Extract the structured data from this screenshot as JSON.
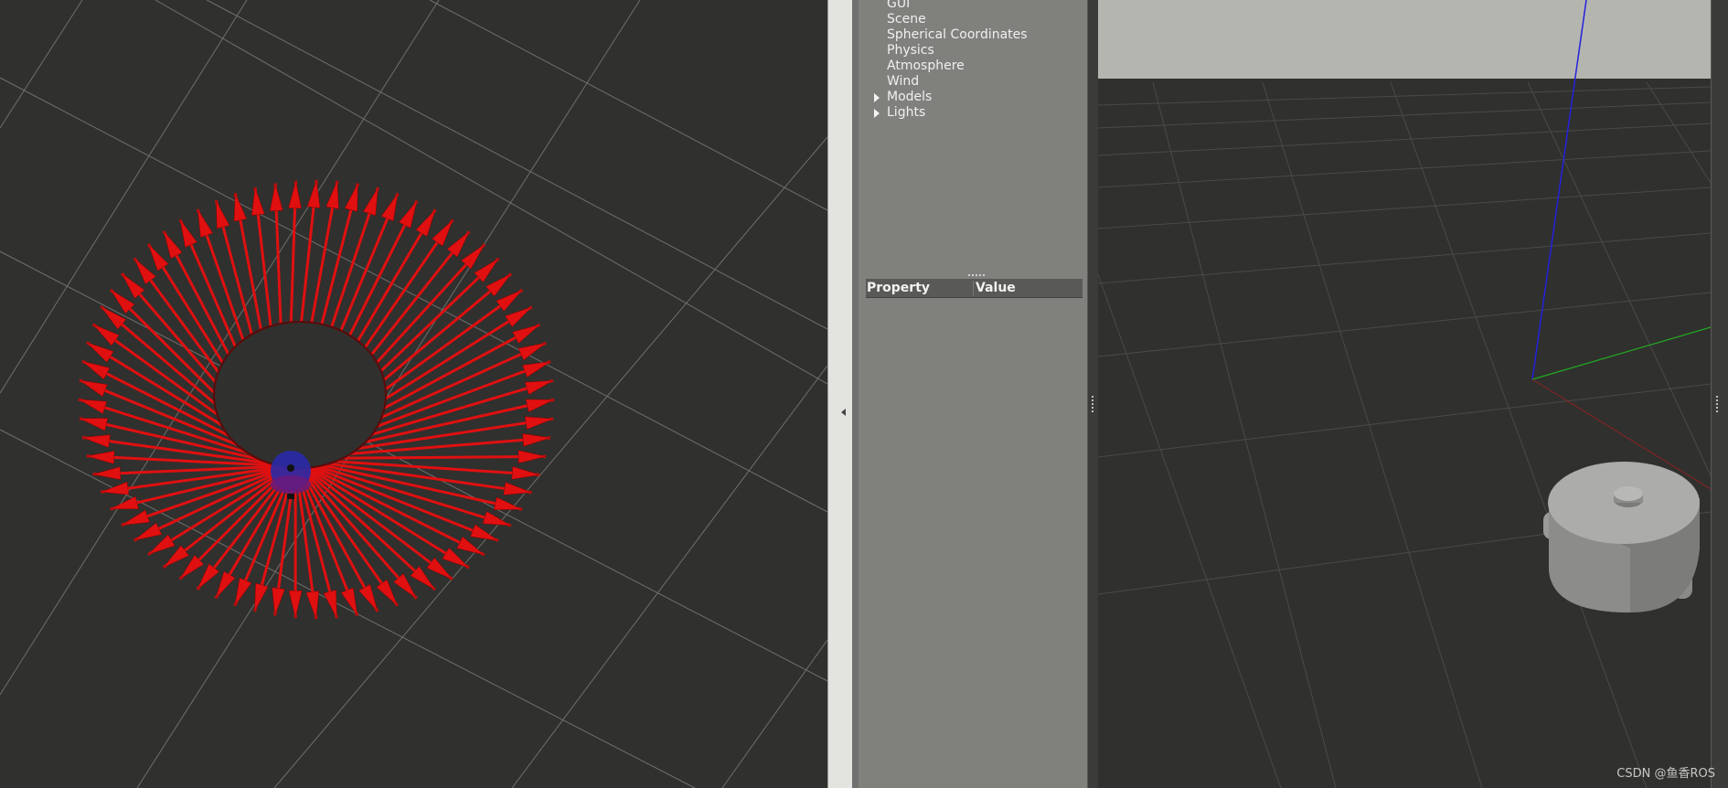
{
  "world_tree": {
    "items": [
      {
        "label": "GUI",
        "expandable": false
      },
      {
        "label": "Scene",
        "expandable": false
      },
      {
        "label": "Spherical Coordinates",
        "expandable": false
      },
      {
        "label": "Physics",
        "expandable": false
      },
      {
        "label": "Atmosphere",
        "expandable": false
      },
      {
        "label": "Wind",
        "expandable": false
      },
      {
        "label": "Models",
        "expandable": true
      },
      {
        "label": "Lights",
        "expandable": true
      }
    ]
  },
  "property_table": {
    "col_property": "Property",
    "col_value": "Value"
  },
  "watermark": "CSDN @鱼香ROS",
  "colors": {
    "arrow_red": "#e01010",
    "robot_blue": "#2a2aa8",
    "axis_z": "#2222dd",
    "axis_y": "#22aa22",
    "axis_x": "#aa2222",
    "sky": "#b5b5b0",
    "ground": "#30302e"
  },
  "icons": {
    "expand": "triangle-right-icon",
    "collapse_panel": "triangle-left-icon"
  }
}
